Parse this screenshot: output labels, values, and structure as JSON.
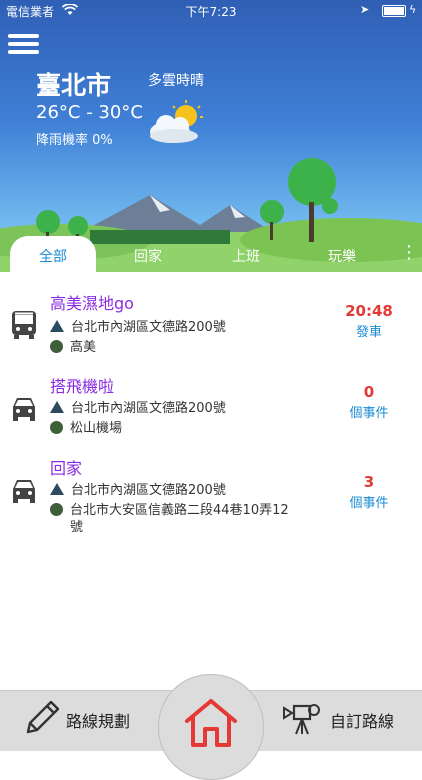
{
  "status": {
    "carrier": "電信業者",
    "time": "下午7:23"
  },
  "weather": {
    "city": "臺北市",
    "condition": "多雲時晴",
    "temperature": "26°C - 30°C",
    "rain": "降雨機率 0%",
    "icon": "partly-cloudy-icon"
  },
  "tabs": [
    "全部",
    "回家",
    "上班",
    "玩樂"
  ],
  "items": [
    {
      "icon": "bus-icon",
      "title": "高美濕地go",
      "from": "台北市內湖區文德路200號",
      "to": "高美",
      "right_big": "20:48",
      "right_small": "發車"
    },
    {
      "icon": "car-icon",
      "title": "搭飛機啦",
      "from": "台北市內湖區文德路200號",
      "to": "松山機場",
      "right_big": "0",
      "right_small": "個事件"
    },
    {
      "icon": "car-icon",
      "title": "回家",
      "from": "台北市內湖區文德路200號",
      "to": "台北市大安區信義路二段44巷10弄12",
      "to_line2": "號",
      "right_big": "3",
      "right_small": "個事件"
    }
  ],
  "bottom": {
    "left_label": "路線規劃",
    "right_label": "自訂路線"
  },
  "colors": {
    "title": "#8a2be2",
    "red": "#e53935",
    "blue": "#1a8bd6"
  }
}
